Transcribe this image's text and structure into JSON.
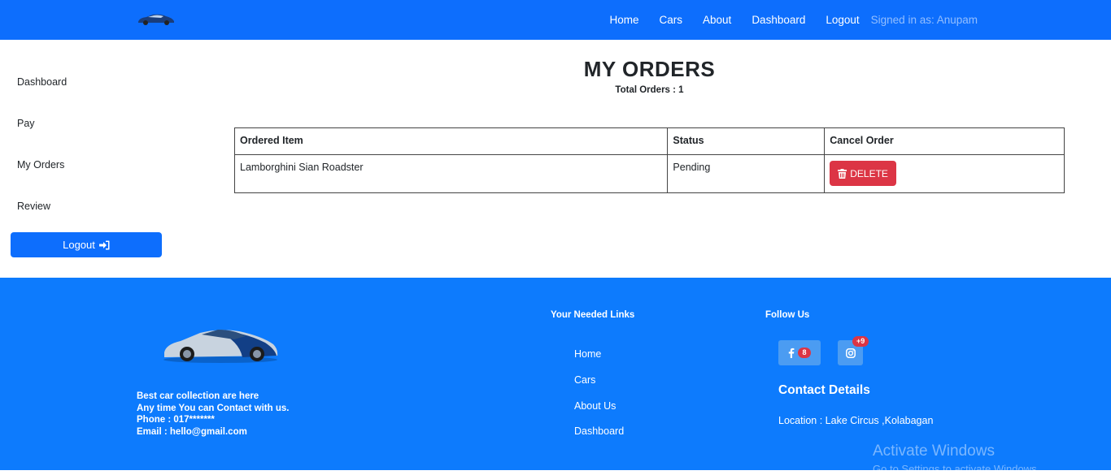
{
  "navbar": {
    "logo_icon": "car-logo-icon",
    "links": [
      "Home",
      "Cars",
      "About",
      "Dashboard",
      "Logout"
    ],
    "signed_in": "Signed in as: Anupam"
  },
  "sidebar": {
    "items": [
      "Dashboard",
      "Pay",
      "My Orders",
      "Review"
    ],
    "logout_label": "Logout",
    "logout_icon": "sign-in-icon"
  },
  "main": {
    "title": "MY ORDERS",
    "total_orders": "Total Orders : 1",
    "table": {
      "headers": [
        "Ordered Item",
        "Status",
        "Cancel Order"
      ],
      "rows": [
        {
          "item": "Lamborghini Sian Roadster",
          "status": "Pending",
          "action": "DELETE",
          "action_icon": "trash-icon"
        }
      ]
    }
  },
  "footer": {
    "car_image": "car-image",
    "about_lines": [
      "Best car collection are here",
      "Any time You can Contact with us.",
      "Phone : 017*******",
      "Email : hello@gmail.com"
    ],
    "links_title": "Your Needed Links",
    "links": [
      "Home",
      "Cars",
      "About Us",
      "Dashboard"
    ],
    "follow_title": "Follow Us",
    "social": [
      {
        "icon": "facebook-icon",
        "badge": "8"
      },
      {
        "icon": "instagram-icon",
        "badge": "+9"
      }
    ],
    "contact_title": "Contact Details",
    "location": "Location : Lake Circus ,Kolabagan"
  },
  "watermark": {
    "line1": "Activate Windows",
    "line2": "Go to Settings to activate Windows."
  },
  "colors": {
    "primary": "#0d6efd",
    "footer_bg": "#0d7bfd",
    "danger": "#dc3545"
  }
}
